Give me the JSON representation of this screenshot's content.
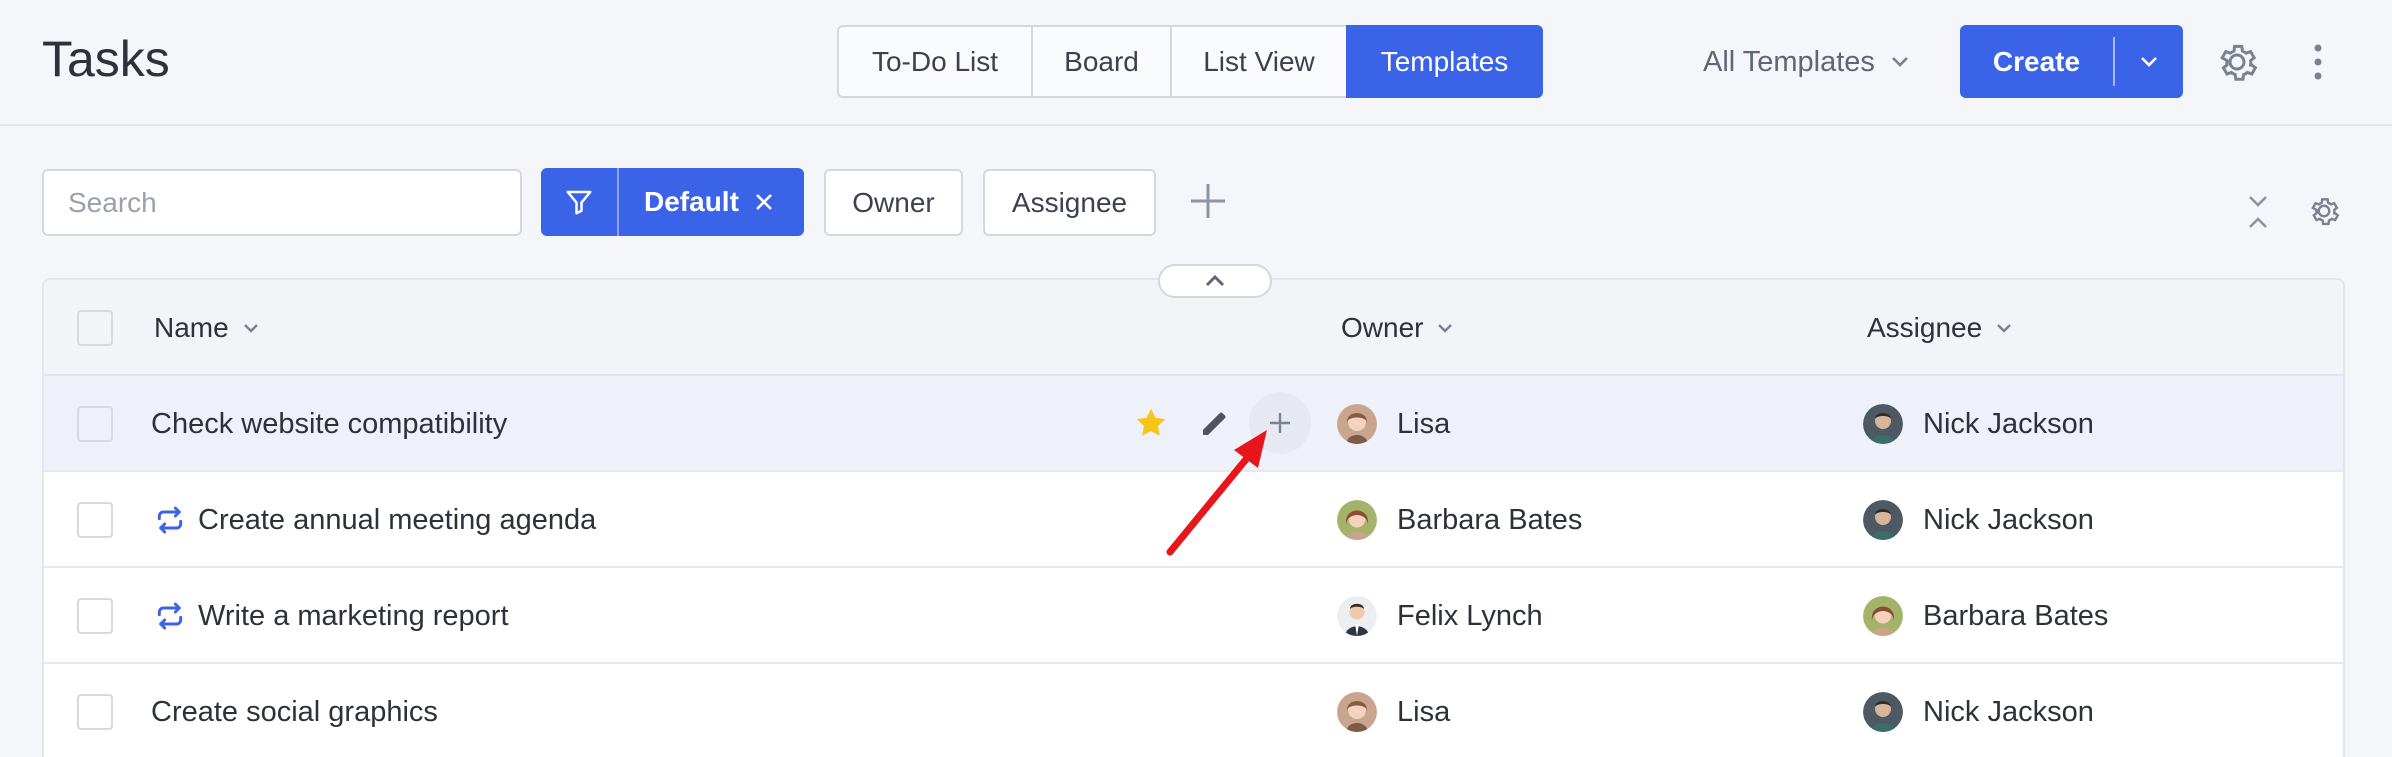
{
  "page_title": "Tasks",
  "view_tabs": [
    {
      "label": "To-Do List"
    },
    {
      "label": "Board"
    },
    {
      "label": "List View"
    },
    {
      "label": "Templates"
    }
  ],
  "active_tab": "Templates",
  "templates_filter": {
    "label": "All Templates"
  },
  "create_button": {
    "label": "Create"
  },
  "search": {
    "placeholder": "Search",
    "value": ""
  },
  "filter_chip": {
    "label": "Default"
  },
  "field_filters": [
    {
      "label": "Owner"
    },
    {
      "label": "Assignee"
    }
  ],
  "table": {
    "columns": {
      "name": "Name",
      "owner": "Owner",
      "assignee": "Assignee"
    },
    "rows": [
      {
        "name": "Check website compatibility",
        "recurring": false,
        "owner": "Lisa",
        "assignee": "Nick Jackson",
        "starred": true
      },
      {
        "name": "Create annual meeting agenda",
        "recurring": true,
        "owner": "Barbara Bates",
        "assignee": "Nick Jackson",
        "starred": false
      },
      {
        "name": "Write a marketing report",
        "recurring": true,
        "owner": "Felix Lynch",
        "assignee": "Barbara Bates",
        "starred": false
      },
      {
        "name": "Create social graphics",
        "recurring": false,
        "owner": "Lisa",
        "assignee": "Nick Jackson",
        "starred": false
      }
    ]
  },
  "colors": {
    "accent": "#3a63e8",
    "star": "#f5c518",
    "annotation_arrow": "#e8151b"
  },
  "icons": [
    "chevron-down-icon",
    "gear-icon",
    "kebab-menu-icon",
    "filter-icon",
    "close-icon",
    "plus-icon",
    "collapse-icon",
    "chevron-up-icon",
    "recurring-icon",
    "star-icon",
    "pencil-icon",
    "avatar"
  ]
}
